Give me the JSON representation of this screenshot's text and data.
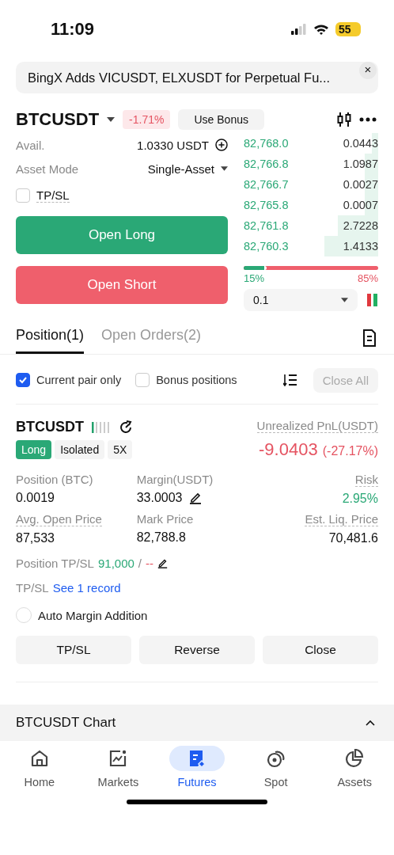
{
  "status_bar": {
    "time": "11:09",
    "battery": "55"
  },
  "announcement": {
    "text": "BingX Adds VICUSDT, ELXUSDT  for Perpetual Fu...",
    "close": "×"
  },
  "header": {
    "symbol": "BTCUSDT",
    "change": "-1.71%",
    "bonus_button": "Use Bonus"
  },
  "form": {
    "avail_label": "Avail.",
    "avail_value": "1.0330 USDT",
    "mode_label": "Asset Mode",
    "mode_value": "Single-Asset",
    "tpsl": {
      "label": "TP/SL",
      "checked": false
    },
    "long_button": "Open Long",
    "short_button": "Open Short"
  },
  "order_book": {
    "rows": [
      {
        "price": "82,768.0",
        "qty": "0.0443"
      },
      {
        "price": "82,766.8",
        "qty": "1.0987"
      },
      {
        "price": "82,766.7",
        "qty": "0.0027"
      },
      {
        "price": "82,765.8",
        "qty": "0.0007"
      },
      {
        "price": "82,761.8",
        "qty": "2.7228"
      },
      {
        "price": "82,760.3",
        "qty": "1.4133"
      }
    ],
    "ratio": {
      "level": 0.15,
      "buy_label": "15%",
      "sell_label": "85%"
    },
    "precision": "0.1"
  },
  "tabs": [
    {
      "label": "Position(1)",
      "selected": true
    },
    {
      "label": "Open Orders(2)",
      "selected": false
    }
  ],
  "filters": [
    {
      "label": "Current pair only",
      "checked": true
    },
    {
      "label": "Bonus positions",
      "checked": false
    }
  ],
  "close_all": "Close All",
  "position": {
    "symbol": "BTCUSDT",
    "tags": [
      {
        "label": "Long",
        "kind": "side"
      },
      {
        "label": "Isolated",
        "kind": "plain"
      },
      {
        "label": "5X",
        "kind": "plain"
      }
    ],
    "pnl_label": "Unrealized PnL(USDT)",
    "pnl_value": "-9.0403",
    "pnl_pct": "(-27.17%)",
    "stats": [
      {
        "label": "Position (BTC)",
        "value": "0.0019",
        "kind": "plain"
      },
      {
        "label": "Margin(USDT)",
        "value": "33.0003",
        "kind": "edit"
      },
      {
        "label": "Risk",
        "value": "2.95%",
        "kind": "good"
      },
      {
        "label": "Avg. Open Price",
        "value": "87,533",
        "kind": "plain"
      },
      {
        "label": "Mark Price",
        "value": "82,788.8",
        "kind": "plain"
      },
      {
        "label": "Est. Liq. Price",
        "value": "70,481.6",
        "kind": "plain"
      }
    ],
    "tpsl_label": "Position TP/SL",
    "tp_value": "91,000",
    "slash": "/",
    "sl_value": "--",
    "record_label": "TP/SL",
    "record_link": "See 1 record",
    "auto_margin": {
      "label": "Auto Margin Addition",
      "checked": false
    },
    "actions": [
      "TP/SL",
      "Reverse",
      "Close"
    ]
  },
  "chart_section": {
    "title": "BTCUSDT Chart"
  },
  "nav": [
    {
      "label": "Home",
      "selected": false
    },
    {
      "label": "Markets",
      "selected": false
    },
    {
      "label": "Futures",
      "selected": true
    },
    {
      "label": "Spot",
      "selected": false
    },
    {
      "label": "Assets",
      "selected": false
    }
  ]
}
